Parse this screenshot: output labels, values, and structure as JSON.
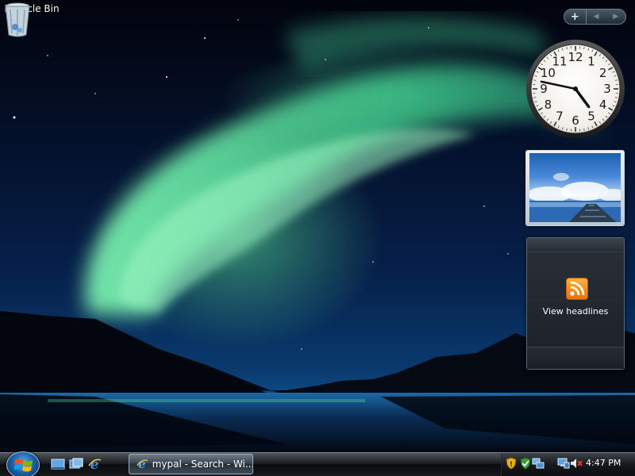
{
  "desktop": {
    "icons": [
      {
        "label": "Recycle Bin",
        "icon": "recycle-bin-icon"
      }
    ]
  },
  "sidebar": {
    "toolbar": {
      "add_label": "+",
      "prev_label": "◀",
      "next_label": "▶"
    },
    "clock": {
      "numerals": [
        "12",
        "1",
        "2",
        "3",
        "4",
        "5",
        "6",
        "7",
        "8",
        "9",
        "10",
        "11"
      ],
      "hour": 4,
      "minute": 47
    },
    "feed": {
      "link_label": "View headlines",
      "icon": "rss-icon"
    }
  },
  "taskbar": {
    "start_icon": "windows-logo-icon",
    "quick_launch": [
      "show-desktop-icon",
      "switch-windows-icon",
      "internet-explorer-icon"
    ],
    "tasks": [
      {
        "label": "mypal - Search - Wi...",
        "icon": "internet-explorer-icon"
      }
    ],
    "tray": {
      "icons": [
        "security-shield-icon",
        "windows-update-icon",
        "network-icon",
        "volume-muted-icon"
      ],
      "time": "4:47 PM"
    }
  },
  "colors": {
    "aurora": "#5ee39a",
    "sky": "#06204a",
    "taskbar": "#15181c",
    "rss_orange": "#f08a1c"
  }
}
